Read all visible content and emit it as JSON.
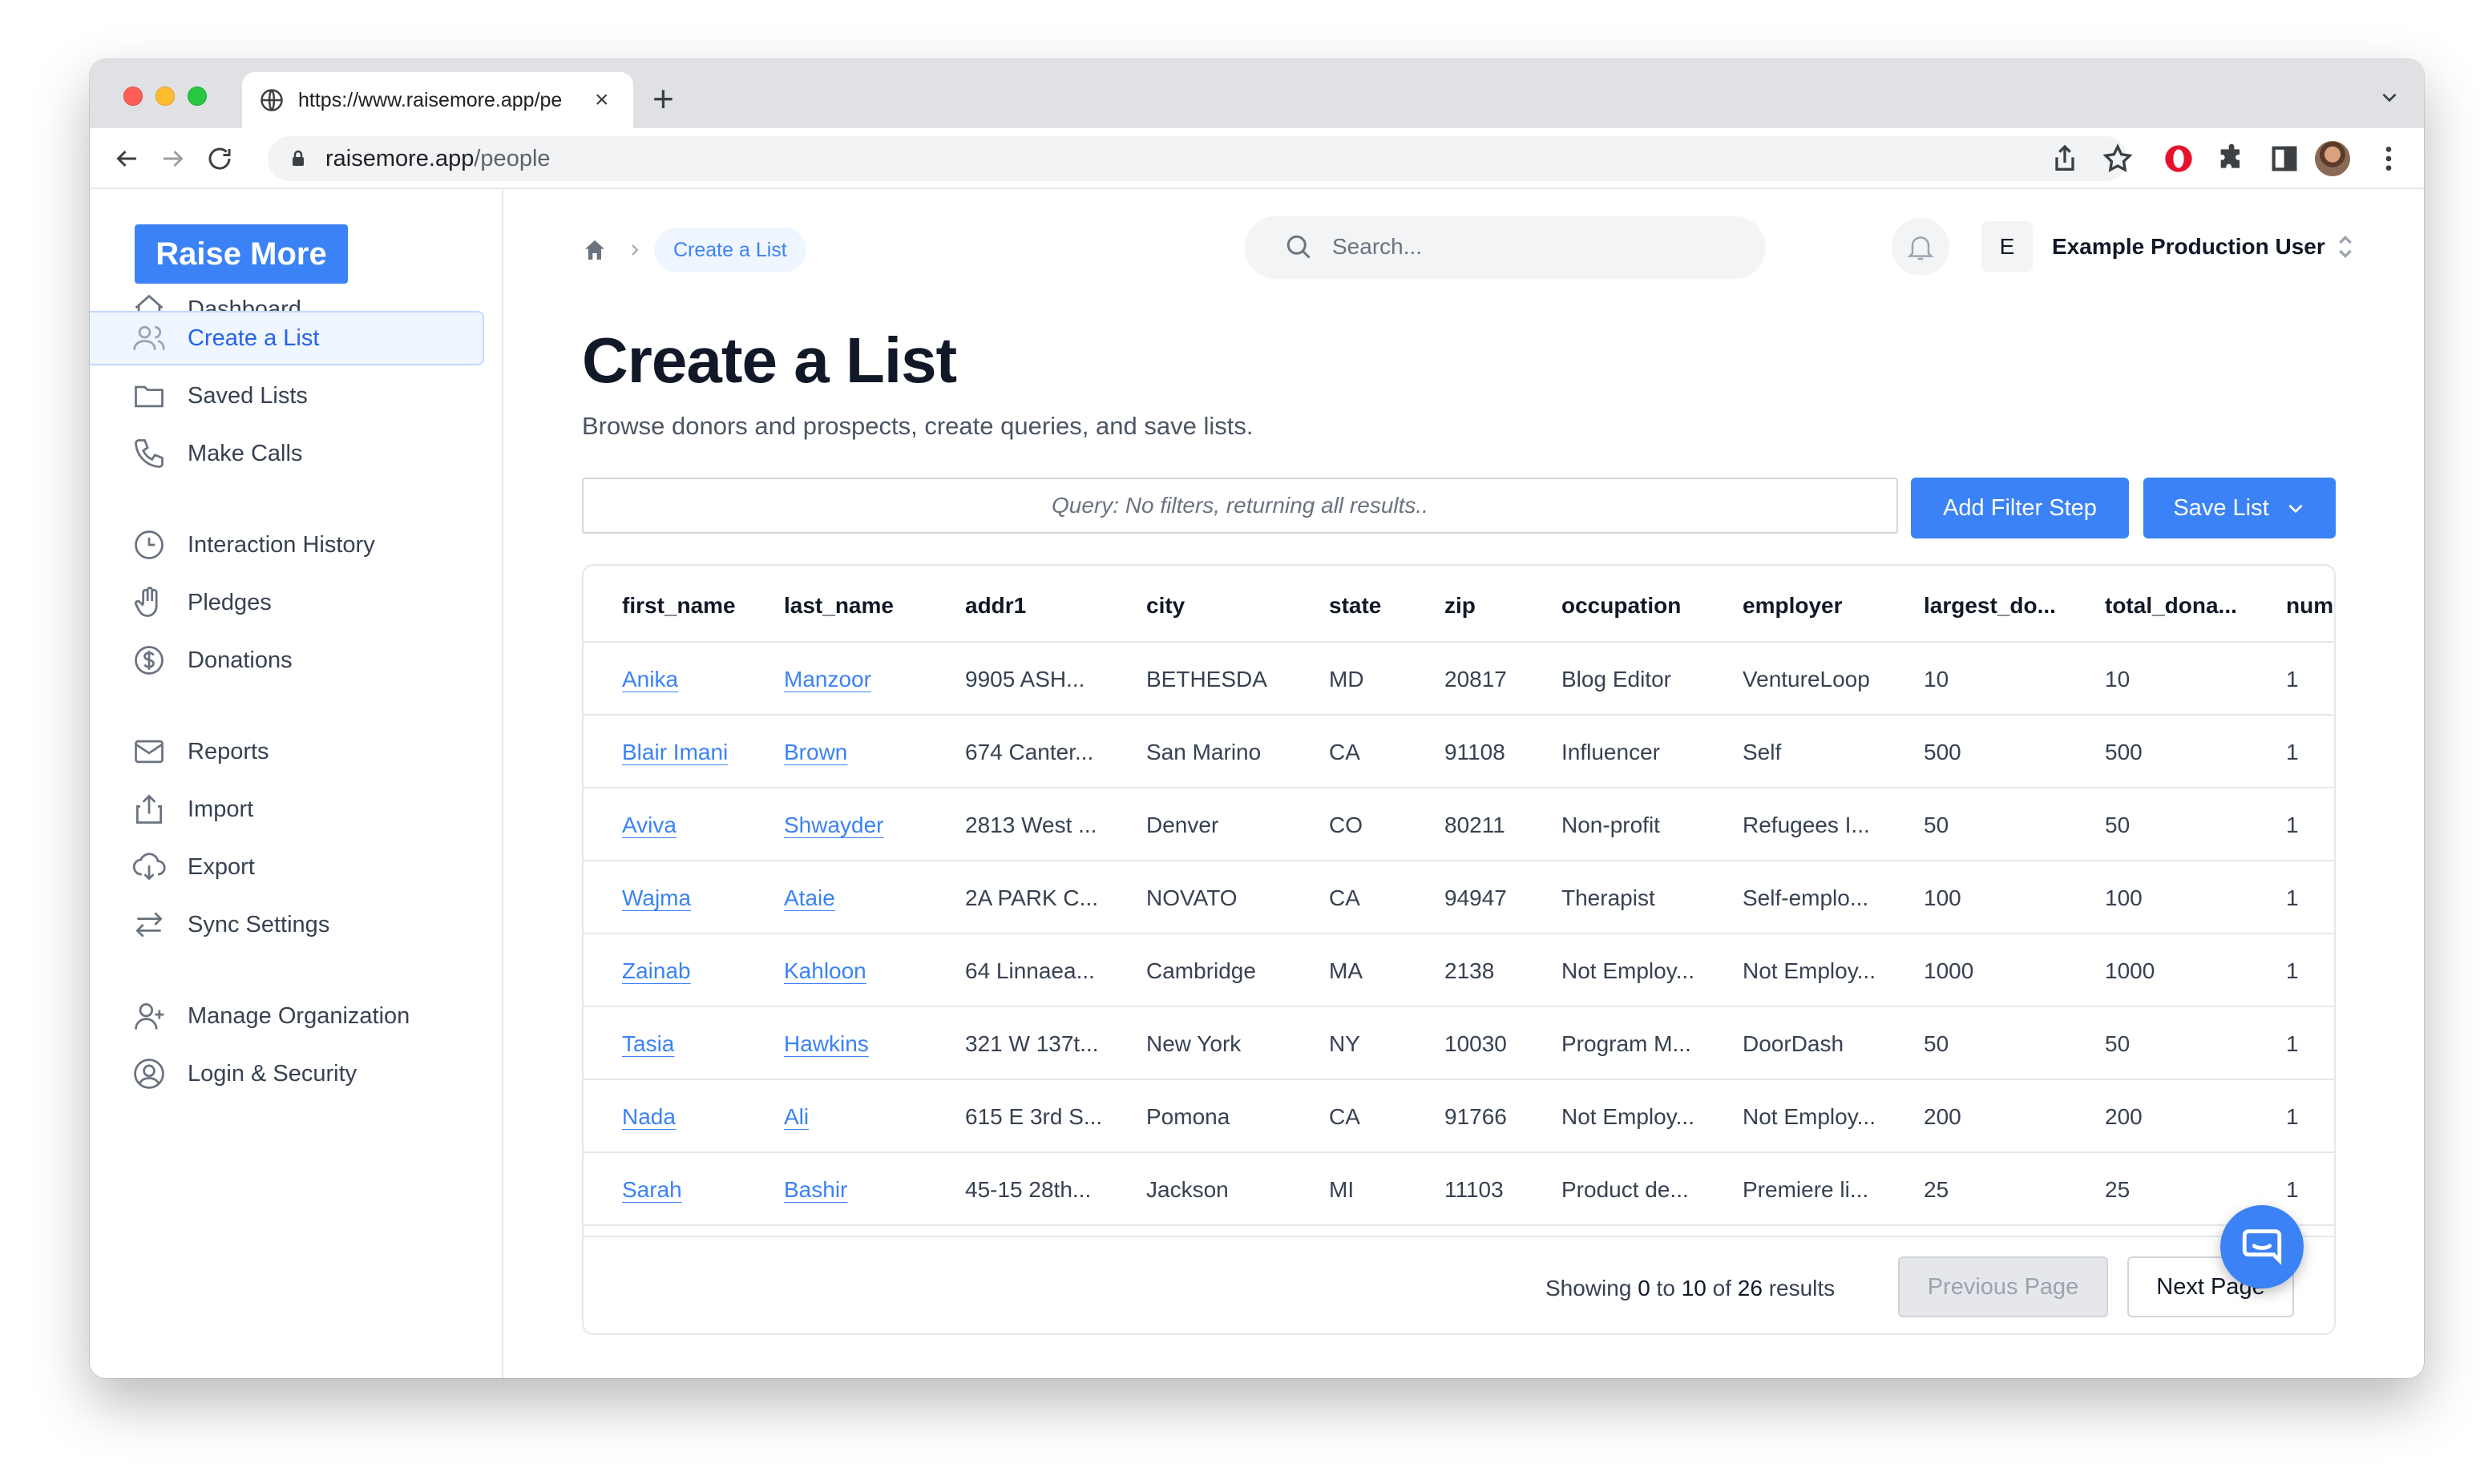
{
  "browser": {
    "tab_title": "https://www.raisemore.app/pe",
    "tab_close": "×",
    "new_tab": "+",
    "url_host": "raisemore.app",
    "url_path": "/people"
  },
  "sidebar": {
    "logo": "Raise More",
    "items": [
      {
        "label": "Dashboard",
        "icon": "home-icon"
      },
      {
        "label": "Create a List",
        "icon": "users-icon",
        "active": true
      },
      {
        "label": "Saved Lists",
        "icon": "folder-icon"
      },
      {
        "label": "Make Calls",
        "icon": "phone-icon"
      },
      {
        "label": "Interaction History",
        "icon": "clock-icon"
      },
      {
        "label": "Pledges",
        "icon": "hand-icon"
      },
      {
        "label": "Donations",
        "icon": "dollar-icon"
      },
      {
        "label": "Reports",
        "icon": "mail-icon"
      },
      {
        "label": "Import",
        "icon": "upload-icon"
      },
      {
        "label": "Export",
        "icon": "download-icon"
      },
      {
        "label": "Sync Settings",
        "icon": "arrows-icon"
      },
      {
        "label": "Manage Organization",
        "icon": "user-plus-icon"
      },
      {
        "label": "Login & Security",
        "icon": "user-circle-icon"
      }
    ]
  },
  "header": {
    "breadcrumb": "Create a List",
    "search_placeholder": "Search...",
    "org_initial": "E",
    "org_name": "Example Production User"
  },
  "page": {
    "title": "Create a List",
    "subtitle": "Browse donors and prospects, create queries, and save lists.",
    "query_text": "Query: No filters, returning all results..",
    "add_filter_label": "Add Filter Step",
    "save_list_label": "Save List"
  },
  "table": {
    "columns": [
      "first_name",
      "last_name",
      "addr1",
      "city",
      "state",
      "zip",
      "occupation",
      "employer",
      "largest_do...",
      "total_dona...",
      "num"
    ],
    "rows": [
      [
        "Anika",
        "Manzoor",
        "9905 ASH...",
        "BETHESDA",
        "MD",
        "20817",
        "Blog Editor",
        "VentureLoop",
        "10",
        "10",
        "1"
      ],
      [
        "Blair Imani",
        "Brown",
        "674 Canter...",
        "San Marino",
        "CA",
        "91108",
        "Influencer",
        "Self",
        "500",
        "500",
        "1"
      ],
      [
        "Aviva",
        "Shwayder",
        "2813 West ...",
        "Denver",
        "CO",
        "80211",
        "Non-profit",
        "Refugees I...",
        "50",
        "50",
        "1"
      ],
      [
        "Wajma",
        "Ataie",
        "2A PARK C...",
        "NOVATO",
        "CA",
        "94947",
        "Therapist",
        "Self-emplo...",
        "100",
        "100",
        "1"
      ],
      [
        "Zainab",
        "Kahloon",
        "64 Linnaea...",
        "Cambridge",
        "MA",
        "2138",
        "Not Employ...",
        "Not Employ...",
        "1000",
        "1000",
        "1"
      ],
      [
        "Tasia",
        "Hawkins",
        "321 W 137t...",
        "New York",
        "NY",
        "10030",
        "Program M...",
        "DoorDash",
        "50",
        "50",
        "1"
      ],
      [
        "Nada",
        "Ali",
        "615 E 3rd S...",
        "Pomona",
        "CA",
        "91766",
        "Not Employ...",
        "Not Employ...",
        "200",
        "200",
        "1"
      ],
      [
        "Sarah",
        "Bashir",
        "45-15 28th...",
        "Jackson",
        "MI",
        "11103",
        "Product de...",
        "Premiere li...",
        "25",
        "25",
        "1"
      ]
    ],
    "pagination": {
      "showing_prefix": "Showing",
      "from": "0",
      "to_word": "to",
      "to": "10",
      "of_word": "of",
      "total": "26",
      "results_word": "results",
      "prev_label": "Previous Page",
      "next_label": "Next Page"
    }
  },
  "colors": {
    "accent": "#3b82f6",
    "active_bg": "#eff6ff"
  }
}
